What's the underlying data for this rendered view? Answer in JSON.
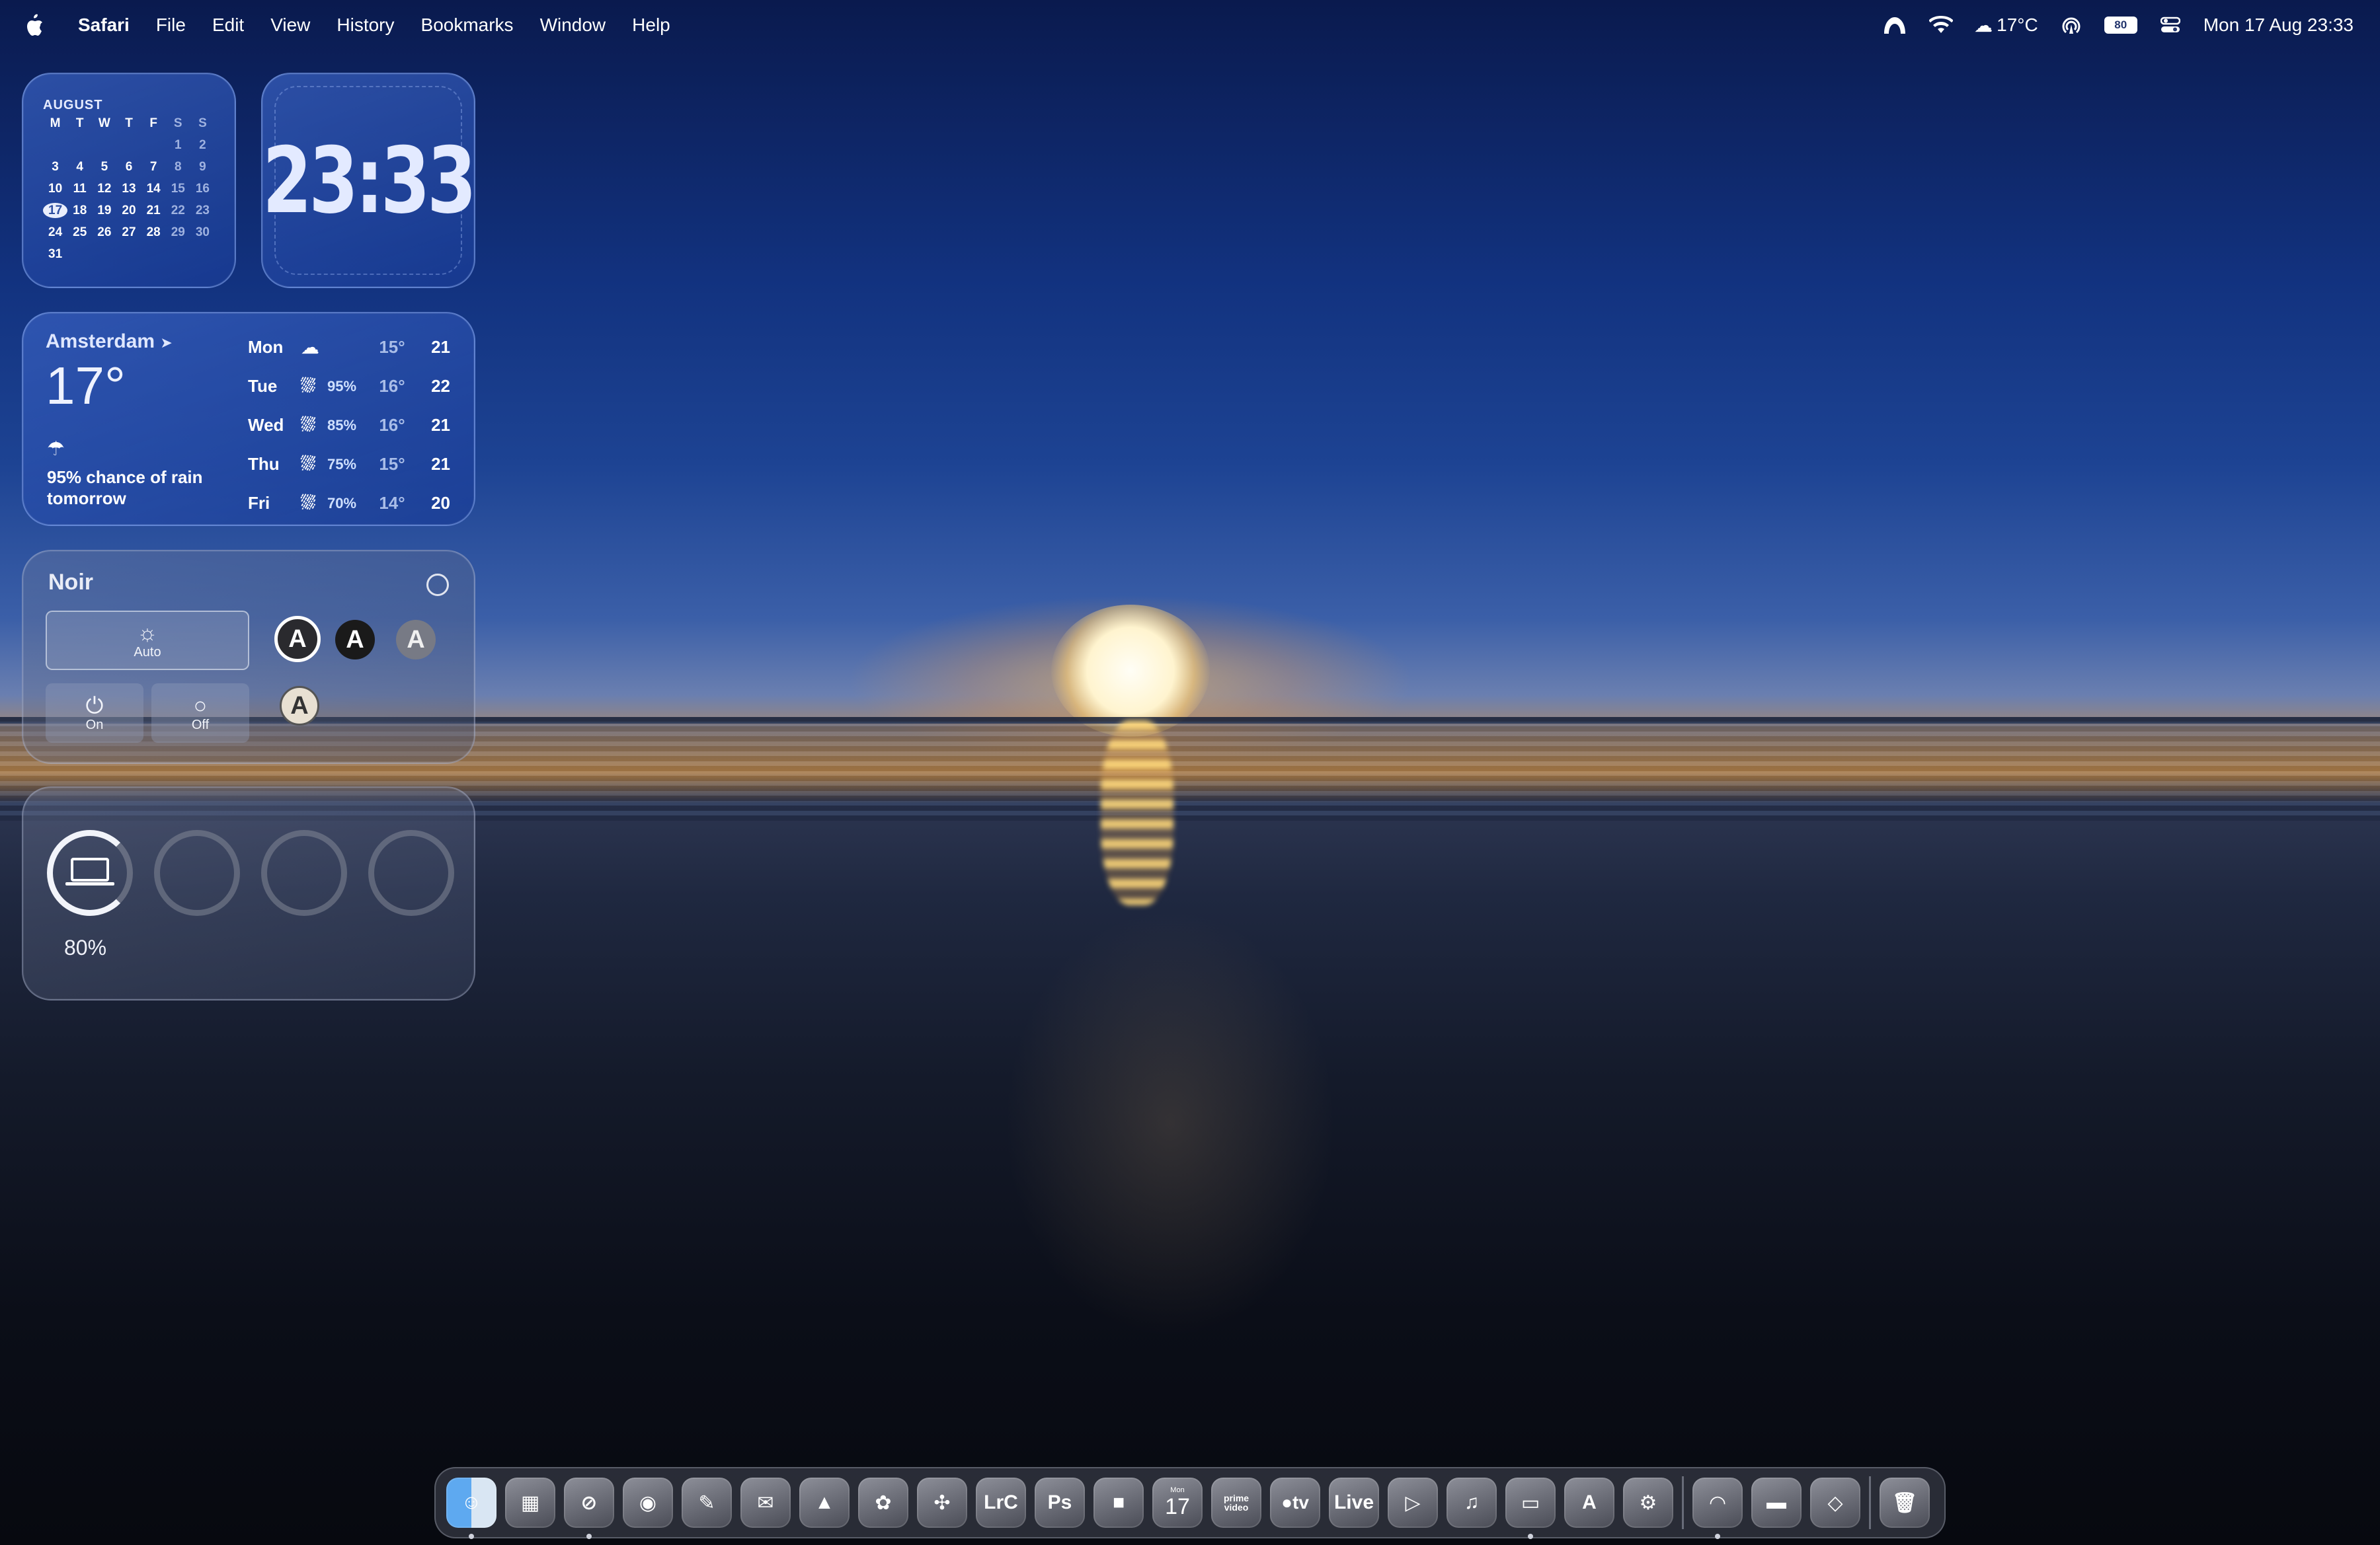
{
  "menubar": {
    "app_name": "Safari",
    "items": [
      "File",
      "Edit",
      "View",
      "History",
      "Bookmarks",
      "Window",
      "Help"
    ],
    "status": {
      "weather": "17°C",
      "battery": "80",
      "datetime": "Mon 17 Aug  23:33"
    },
    "icons": [
      "apple-logo-icon",
      "vpn-icon",
      "wifi-icon",
      "cloud-icon",
      "airdrop-icon",
      "battery-icon",
      "control-center-icon"
    ]
  },
  "calendar": {
    "month": "AUGUST",
    "weekdays": [
      "M",
      "T",
      "W",
      "T",
      "F",
      "S",
      "S"
    ],
    "cells": [
      "",
      "",
      "",
      "",
      "",
      "1",
      "2",
      "3",
      "4",
      "5",
      "6",
      "7",
      "8",
      "9",
      "10",
      "11",
      "12",
      "13",
      "14",
      "15",
      "16",
      "17",
      "18",
      "19",
      "20",
      "21",
      "22",
      "23",
      "24",
      "25",
      "26",
      "27",
      "28",
      "29",
      "30",
      "31"
    ],
    "today": "17"
  },
  "clock": {
    "time": "23:33"
  },
  "weather": {
    "city": "Amsterdam",
    "temp": "17°",
    "rain_text": "95% chance of rain tomorrow",
    "forecast": [
      {
        "day": "Mon",
        "precip": "",
        "low": "15°",
        "high": "21"
      },
      {
        "day": "Tue",
        "precip": "95%",
        "low": "16°",
        "high": "22"
      },
      {
        "day": "Wed",
        "precip": "85%",
        "low": "16°",
        "high": "21"
      },
      {
        "day": "Thu",
        "precip": "75%",
        "low": "15°",
        "high": "21"
      },
      {
        "day": "Fri",
        "precip": "70%",
        "low": "14°",
        "high": "20"
      }
    ]
  },
  "noir": {
    "title": "Noir",
    "auto_label": "Auto",
    "on_label": "On",
    "off_label": "Off",
    "icon_letter": "A"
  },
  "battery_widget": {
    "percent_label": "80%",
    "level": 0.8
  },
  "dock": {
    "apps": [
      "Finder",
      "Launchpad",
      "Safari",
      "Chrome",
      "Scripts",
      "Mail",
      "Maps",
      "Photos",
      "Fan",
      "LrC",
      "Ps",
      "FaceTime",
      "Calendar",
      "prime video",
      "tv",
      "Live",
      "Infuse",
      "Music",
      "Preview",
      "App Store",
      "System Settings"
    ],
    "calendar_day": "17",
    "calendar_month": "Mon",
    "lrc_label": "LrC",
    "ps_label": "Ps",
    "prime_label": "prime video",
    "tv_label": "tv",
    "live_label": "Live",
    "extras": [
      "VPN",
      "Screen",
      "Network",
      "Trash"
    ]
  }
}
